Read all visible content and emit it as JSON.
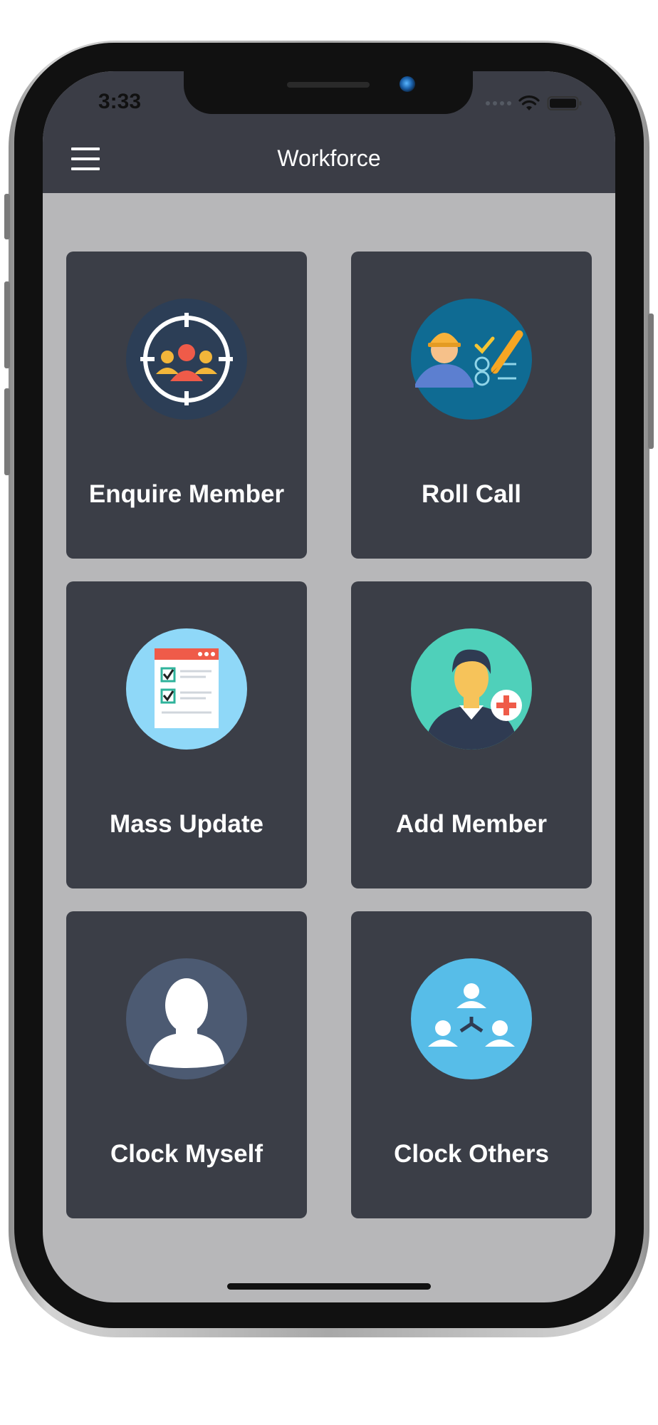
{
  "status_bar": {
    "time": "3:33",
    "signal_icon": "signal-dots-icon",
    "wifi_icon": "wifi-icon",
    "battery_icon": "battery-icon"
  },
  "header": {
    "title": "Workforce",
    "menu_icon": "hamburger-menu-icon"
  },
  "tiles": [
    {
      "label": "Enquire Member",
      "icon": "target-group-icon"
    },
    {
      "label": "Roll Call",
      "icon": "worker-checklist-icon"
    },
    {
      "label": "Mass Update",
      "icon": "checklist-document-icon"
    },
    {
      "label": "Add Member",
      "icon": "add-person-icon"
    },
    {
      "label": "Clock Myself",
      "icon": "person-silhouette-icon"
    },
    {
      "label": "Clock Others",
      "icon": "people-network-icon"
    }
  ],
  "colors": {
    "header_bg": "#3b3d46",
    "tile_bg": "#3b3e47",
    "screen_bg": "#b7b7b9",
    "text": "#ffffff"
  }
}
